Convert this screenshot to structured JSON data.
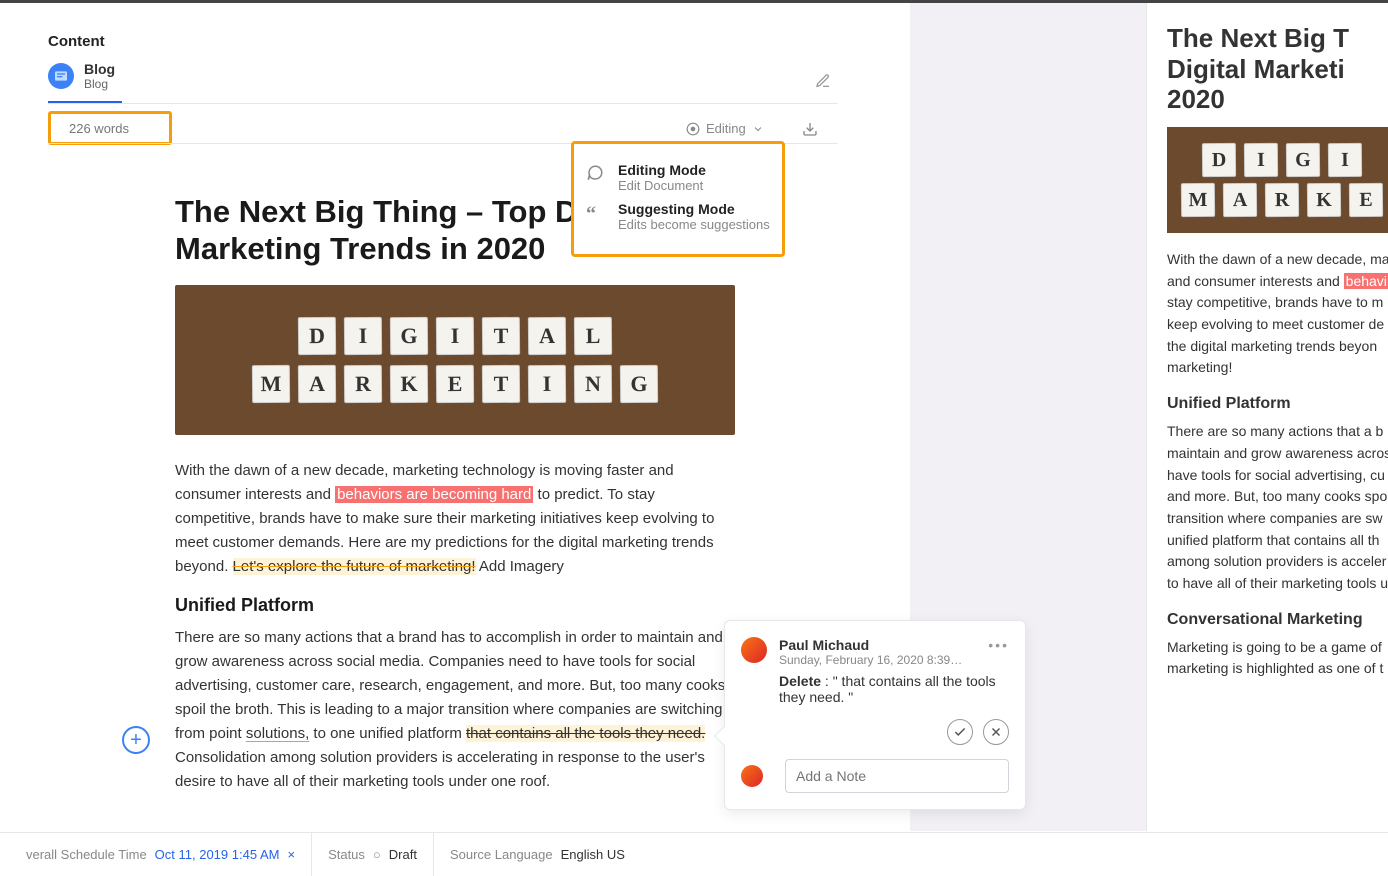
{
  "header": {
    "content_label": "Content",
    "blog_title": "Blog",
    "blog_subtitle": "Blog",
    "word_count": "226 words",
    "editing_label": "Editing"
  },
  "mode_popover": {
    "editing": {
      "title": "Editing Mode",
      "subtitle": "Edit Document"
    },
    "suggesting": {
      "title": "Suggesting Mode",
      "subtitle": "Edits become suggestions"
    }
  },
  "document": {
    "title": "The Next Big Thing – Top Digital Marketing Trends in 2020",
    "hero_letters": {
      "row1": [
        "D",
        "I",
        "G",
        "I",
        "T",
        "A",
        "L"
      ],
      "row2": [
        "M",
        "A",
        "R",
        "K",
        "E",
        "T",
        "I",
        "N",
        "G"
      ]
    },
    "p1_a": "With the dawn of a new decade, marketing technology is moving faster and consumer interests and ",
    "p1_hl": "behaviors are becoming hard",
    "p1_b": " to predict. To stay competitive, brands have to make sure their marketing initiatives keep evolving to meet customer demands. Here are my predictions for the digital marketing trends beyond. ",
    "p1_strike": "Let's explore the future of marketing!",
    "p1_add": " Add Imagery",
    "h2_unified": "Unified Platform",
    "p2_a": "There are so many actions that a brand has to accomplish in order to maintain and grow awareness across social media. Companies need to have tools for social advertising, customer care, research, engagement, and more. But, too many cooks spoil the broth. This is leading to a major transition where companies are switching from point ",
    "p2_und": "solutions,",
    "p2_b": " to one unified platform ",
    "p2_strike": "that contains all the tools they need.",
    "p2_c": " Consolidation among solution providers is accelerating in response to the user's desire to have all of their marketing tools under one roof."
  },
  "comment": {
    "author": "Paul Michaud",
    "date": "Sunday, February 16, 2020 8:39…",
    "action": "Delete",
    "quote": " : \" that contains all the tools they need. \"",
    "note_placeholder": "Add a Note"
  },
  "footer": {
    "schedule_label": "verall Schedule Time",
    "schedule_value": "Oct 11, 2019 1:45 AM",
    "status_label": "Status",
    "status_value": "Draft",
    "lang_label": "Source Language",
    "lang_value": "English US"
  },
  "preview": {
    "title_l1": "The Next Big T",
    "title_l2": "Digital Marketi",
    "title_l3": "2020",
    "p1_l1": "With the dawn of a new decade, ma",
    "p1_l2a": "and consumer interests and ",
    "p1_l2hl": "behavi",
    "p1_l3": "stay competitive, brands have to m",
    "p1_l4": "keep evolving to meet customer de",
    "p1_l5": "the digital marketing trends beyon",
    "p1_l6": "marketing!",
    "h_unified": "Unified Platform",
    "p2_l1": "There are so many actions that a b",
    "p2_l2": "maintain and grow awareness acros",
    "p2_l3": "have tools for social advertising, cu",
    "p2_l4": "and more. But, too many cooks spo",
    "p2_l5": "transition where companies are sw",
    "p2_l6": "unified platform that contains all th",
    "p2_l7": "among solution providers is acceler",
    "p2_l8": "to have all of their marketing tools u",
    "h_conv": "Conversational Marketing",
    "p3_l1": "Marketing is going to be a game of",
    "p3_l2": "marketing is highlighted as one of t"
  }
}
